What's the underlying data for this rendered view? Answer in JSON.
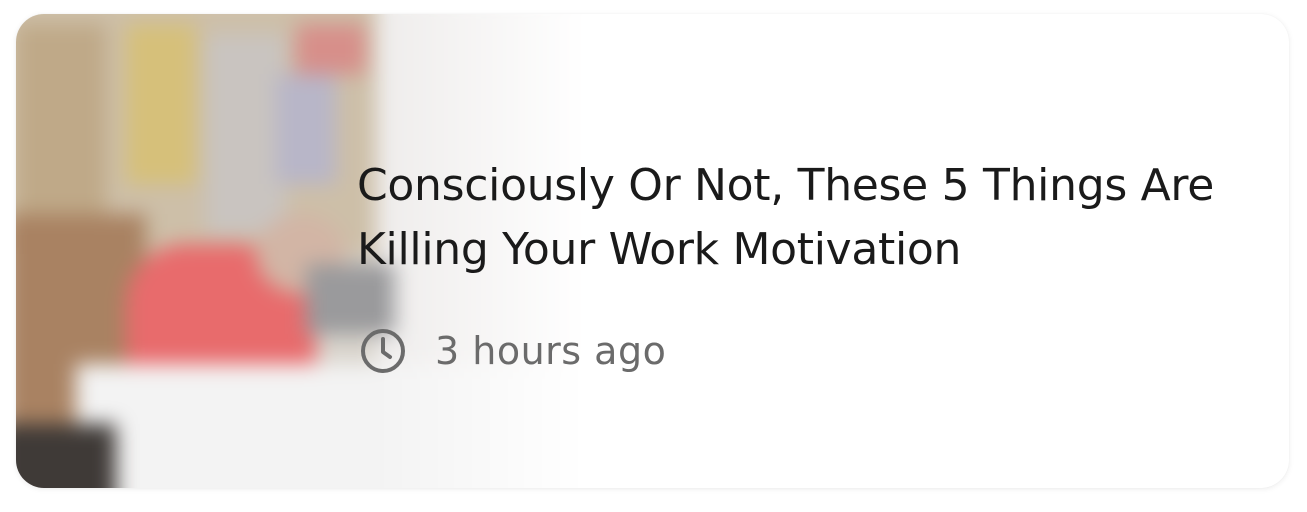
{
  "card": {
    "title": "Consciously Or Not, These 5 Things Are Killing Your Work Motivation",
    "time_ago": "3 hours ago",
    "icon": "clock-icon"
  },
  "colors": {
    "title": "#1a1a1a",
    "meta": "#6b6b6b",
    "background": "#ffffff"
  }
}
